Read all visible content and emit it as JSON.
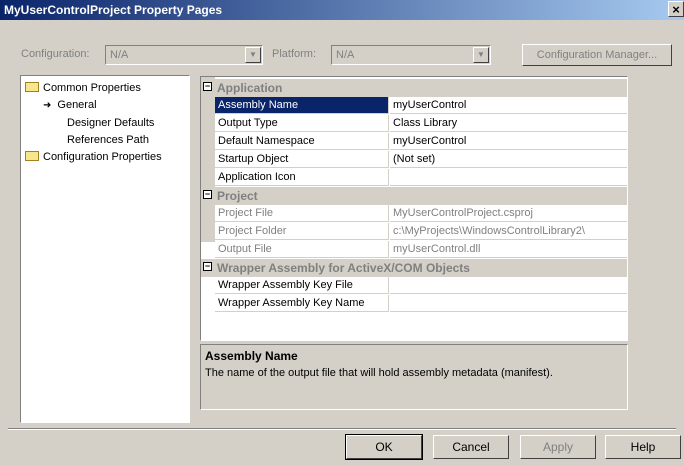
{
  "window": {
    "title": "MyUserControlProject Property Pages",
    "close_glyph": "×"
  },
  "toolbar": {
    "configuration_label": "Configuration:",
    "configuration_value": "N/A",
    "platform_label": "Platform:",
    "platform_value": "N/A",
    "config_manager_label": "Configuration Manager..."
  },
  "tree": {
    "common": "Common Properties",
    "general": "General",
    "designer": "Designer Defaults",
    "references": "References Path",
    "configuration": "Configuration Properties"
  },
  "grid": {
    "cat_application": "Application",
    "cat_project": "Project",
    "cat_wrapper": "Wrapper Assembly for ActiveX/COM Objects",
    "rows": [
      {
        "name": "Assembly Name",
        "value": "myUserControl"
      },
      {
        "name": "Output Type",
        "value": "Class Library"
      },
      {
        "name": "Default Namespace",
        "value": "myUserControl"
      },
      {
        "name": "Startup Object",
        "value": "(Not set)"
      },
      {
        "name": "Application Icon",
        "value": ""
      },
      {
        "name": "Project File",
        "value": "MyUserControlProject.csproj"
      },
      {
        "name": "Project Folder",
        "value": "c:\\MyProjects\\WindowsControlLibrary2\\"
      },
      {
        "name": "Output File",
        "value": "myUserControl.dll"
      },
      {
        "name": "Wrapper Assembly Key File",
        "value": ""
      },
      {
        "name": "Wrapper Assembly Key Name",
        "value": ""
      }
    ]
  },
  "description": {
    "title": "Assembly Name",
    "text": "The name of the output file that will hold assembly metadata (manifest)."
  },
  "buttons": {
    "ok": "OK",
    "cancel": "Cancel",
    "apply": "Apply",
    "help": "Help"
  },
  "colors": {
    "titlebar": "#0a246a",
    "face": "#d4d0c8",
    "selection": "#0a246a"
  }
}
